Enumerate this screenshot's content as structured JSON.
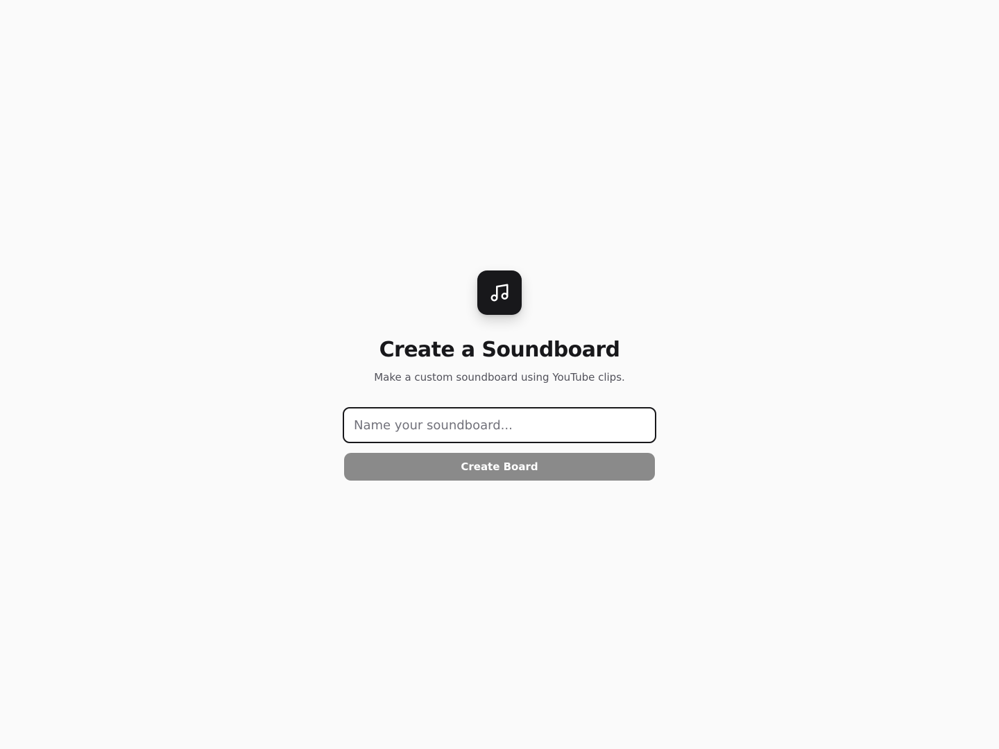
{
  "logo": {
    "icon": "music-note-icon"
  },
  "header": {
    "title": "Create a Soundboard",
    "subtitle": "Make a custom soundboard using YouTube clips."
  },
  "form": {
    "name_value": "",
    "name_placeholder": "Name your soundboard...",
    "submit_label": "Create Board",
    "submit_disabled": true
  },
  "colors": {
    "background": "#fafafa",
    "logo_background": "#18181b",
    "text_primary": "#18181b",
    "text_secondary": "#52525b",
    "button_disabled": "#8a8a8a"
  }
}
